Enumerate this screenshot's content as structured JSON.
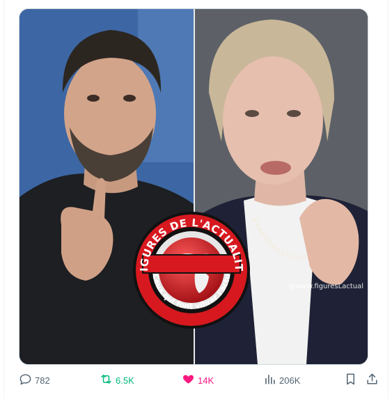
{
  "media": {
    "watermark": "@www.figuresLactual",
    "logo": {
      "top_text": "FIGURES DE L'ACTUALITÉ",
      "bottom_text": "Ceux qui font vibrer l'actu"
    }
  },
  "actions": {
    "replies": "782",
    "reposts": "6.5K",
    "likes": "14K",
    "views": "206K"
  },
  "colors": {
    "repost_active": "#00ba7c",
    "like_active": "#f91880",
    "muted": "#536471",
    "logo_red": "#d7191f"
  }
}
